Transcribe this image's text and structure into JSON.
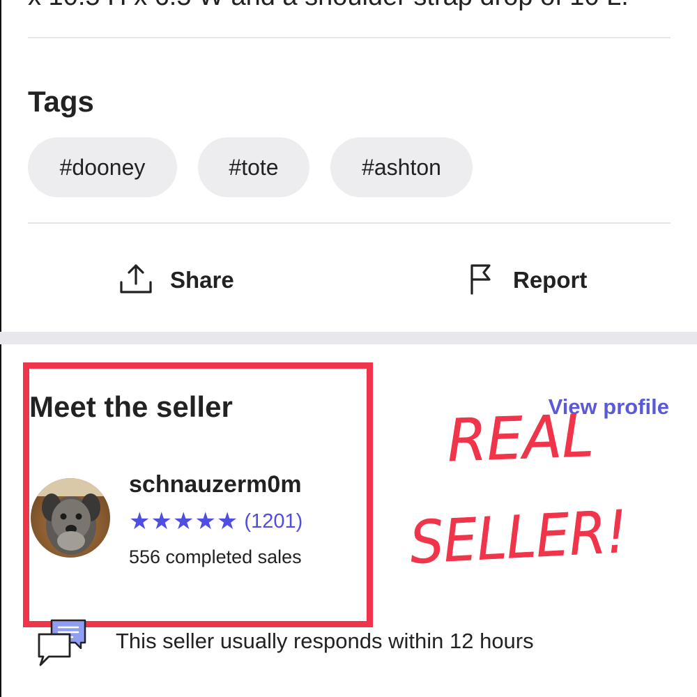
{
  "description_tail": "x 10.5 H x 6.5 W and a shoulder strap drop of 10 L.",
  "tags": {
    "title": "Tags",
    "items": [
      "#dooney",
      "#tote",
      "#ashton"
    ]
  },
  "actions": {
    "share_label": "Share",
    "report_label": "Report"
  },
  "seller": {
    "section_title": "Meet the seller",
    "view_profile_label": "View profile",
    "username": "schnauzerm0m",
    "stars": "★★★★★",
    "rating_count": "(1201)",
    "completed_sales": "556 completed sales",
    "response_note": "This seller usually responds within 12 hours"
  },
  "annotation": {
    "line1": "REAL",
    "line2": "SELLER!",
    "color": "#f0344a"
  },
  "colors": {
    "accent": "#5a5ad6",
    "chip_bg": "#ededf0",
    "divider": "#e6e6ea"
  }
}
